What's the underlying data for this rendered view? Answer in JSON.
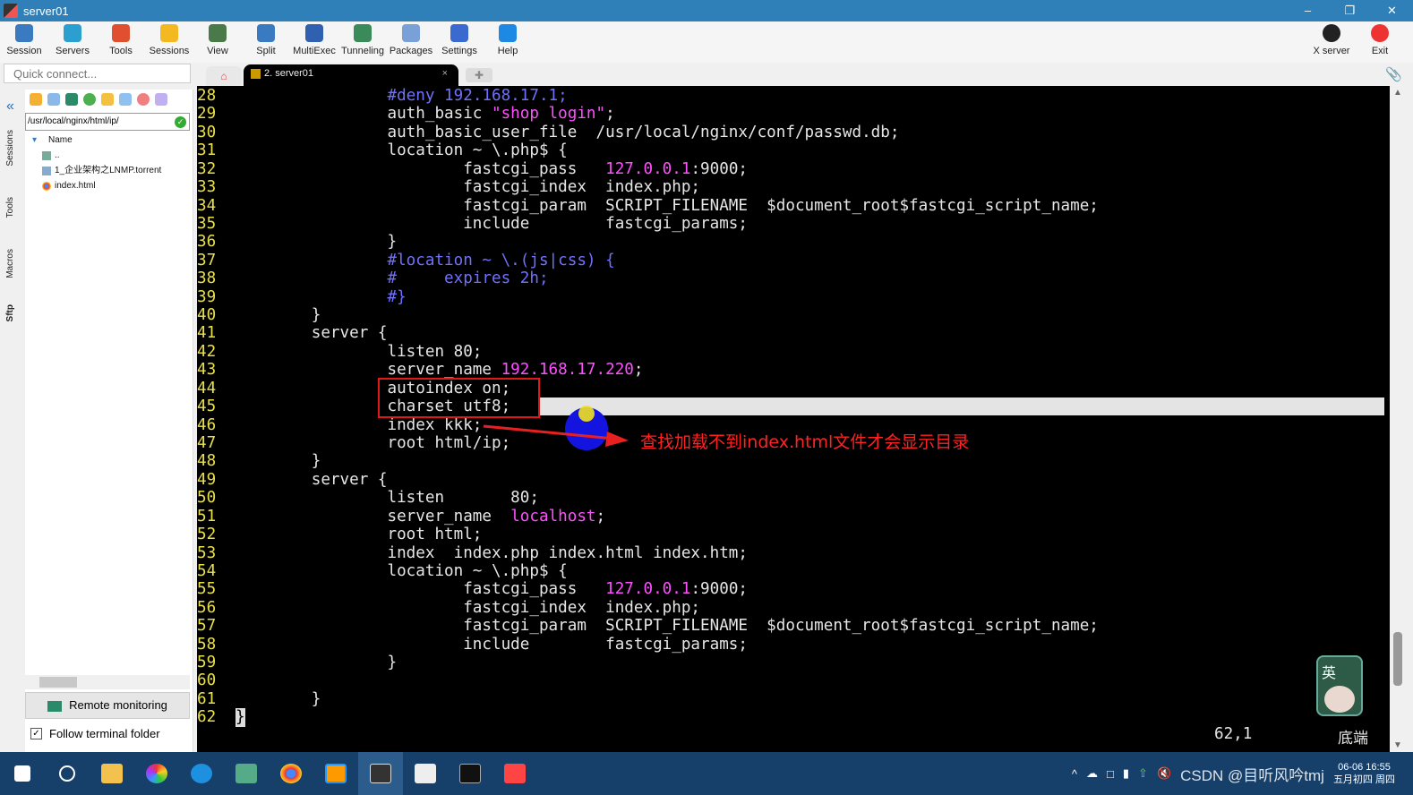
{
  "window": {
    "title": "server01"
  },
  "toolbar": {
    "items": [
      "Session",
      "Servers",
      "Tools",
      "Sessions",
      "View",
      "Split",
      "MultiExec",
      "Tunneling",
      "Packages",
      "Settings",
      "Help"
    ],
    "xserver": "X server",
    "exit": "Exit"
  },
  "quick_connect": {
    "placeholder": "Quick connect..."
  },
  "side_tabs": [
    "Sessions",
    "Tools",
    "Macros",
    "Sftp"
  ],
  "sftp": {
    "path": "/usr/local/nginx/html/ip/",
    "column": "Name",
    "files": [
      "..",
      "1_企业架构之LNMP.torrent",
      "index.html"
    ],
    "remote_monitoring": "Remote monitoring",
    "follow_label": "Follow terminal folder",
    "follow_checked": true
  },
  "tabs": {
    "active": "2. server01"
  },
  "terminal": {
    "lines": [
      {
        "n": "28",
        "s": [
          [
            "                ",
            "n"
          ],
          [
            "#deny 192.168.17.1;",
            "cm"
          ]
        ]
      },
      {
        "n": "29",
        "s": [
          [
            "                auth_basic ",
            "n"
          ],
          [
            "\"shop login\"",
            "st"
          ],
          [
            ";",
            "n"
          ]
        ]
      },
      {
        "n": "30",
        "s": [
          [
            "                auth_basic_user_file  /usr/local/nginx/conf/passwd.db;",
            "n"
          ]
        ]
      },
      {
        "n": "31",
        "s": [
          [
            "                location ~ \\.php$ {",
            "n"
          ]
        ]
      },
      {
        "n": "32",
        "s": [
          [
            "                        fastcgi_pass   ",
            "n"
          ],
          [
            "127.0.0.1",
            "st"
          ],
          [
            ":9000;",
            "n"
          ]
        ]
      },
      {
        "n": "33",
        "s": [
          [
            "                        fastcgi_index  index.php;",
            "n"
          ]
        ]
      },
      {
        "n": "34",
        "s": [
          [
            "                        fastcgi_param  SCRIPT_FILENAME  $document_root$fastcgi_script_name;",
            "n"
          ]
        ]
      },
      {
        "n": "35",
        "s": [
          [
            "                        include        fastcgi_params;",
            "n"
          ]
        ]
      },
      {
        "n": "36",
        "s": [
          [
            "                }",
            "n"
          ]
        ]
      },
      {
        "n": "37",
        "s": [
          [
            "                ",
            "n"
          ],
          [
            "#location ~ \\.(js|css) {",
            "cm"
          ]
        ]
      },
      {
        "n": "38",
        "s": [
          [
            "                ",
            "n"
          ],
          [
            "#     expires 2h;",
            "cm"
          ]
        ]
      },
      {
        "n": "39",
        "s": [
          [
            "                ",
            "n"
          ],
          [
            "#}",
            "cm"
          ]
        ]
      },
      {
        "n": "40",
        "s": [
          [
            "        }",
            "n"
          ]
        ]
      },
      {
        "n": "41",
        "s": [
          [
            "        server {",
            "n"
          ]
        ]
      },
      {
        "n": "42",
        "s": [
          [
            "                listen 80;",
            "n"
          ]
        ]
      },
      {
        "n": "43",
        "s": [
          [
            "                server_name ",
            "n"
          ],
          [
            "192.168.17.220",
            "st"
          ],
          [
            ";",
            "n"
          ]
        ]
      },
      {
        "n": "44",
        "s": [
          [
            "                autoindex on;",
            "n"
          ]
        ]
      },
      {
        "n": "45",
        "s": [
          [
            "                charset utf8;",
            "n"
          ]
        ]
      },
      {
        "n": "46",
        "s": [
          [
            "                index kkk;",
            "n"
          ]
        ]
      },
      {
        "n": "47",
        "s": [
          [
            "                root html/ip;",
            "n"
          ]
        ]
      },
      {
        "n": "48",
        "s": [
          [
            "        }",
            "n"
          ]
        ]
      },
      {
        "n": "49",
        "s": [
          [
            "        server {",
            "n"
          ]
        ]
      },
      {
        "n": "50",
        "s": [
          [
            "                listen       80;",
            "n"
          ]
        ]
      },
      {
        "n": "51",
        "s": [
          [
            "                server_name  ",
            "n"
          ],
          [
            "localhost",
            "st"
          ],
          [
            ";",
            "n"
          ]
        ]
      },
      {
        "n": "52",
        "s": [
          [
            "                root html;",
            "n"
          ]
        ]
      },
      {
        "n": "53",
        "s": [
          [
            "                index  index.php index.html index.htm;",
            "n"
          ]
        ]
      },
      {
        "n": "54",
        "s": [
          [
            "                location ~ \\.php$ {",
            "n"
          ]
        ]
      },
      {
        "n": "55",
        "s": [
          [
            "                        fastcgi_pass   ",
            "n"
          ],
          [
            "127.0.0.1",
            "st"
          ],
          [
            ":9000;",
            "n"
          ]
        ]
      },
      {
        "n": "56",
        "s": [
          [
            "                        fastcgi_index  index.php;",
            "n"
          ]
        ]
      },
      {
        "n": "57",
        "s": [
          [
            "                        fastcgi_param  SCRIPT_FILENAME  $document_root$fastcgi_script_name;",
            "n"
          ]
        ]
      },
      {
        "n": "58",
        "s": [
          [
            "                        include        fastcgi_params;",
            "n"
          ]
        ]
      },
      {
        "n": "59",
        "s": [
          [
            "                }",
            "n"
          ]
        ]
      },
      {
        "n": "60",
        "s": [
          [
            "",
            "n"
          ]
        ]
      },
      {
        "n": "61",
        "s": [
          [
            "        }",
            "n"
          ]
        ]
      },
      {
        "n": "62",
        "s": [
          [
            "}",
            "cursor"
          ]
        ]
      }
    ],
    "cursorline": "45",
    "annotation": "查找加载不到index.html文件才会显示目录",
    "position": "62,1",
    "scroll_status": "底端",
    "ime_label": "英"
  },
  "taskbar": {
    "clock_time": "06-06 16:55",
    "clock_date": "五月初四 周四",
    "watermark": "CSDN @目听风吟tmj"
  },
  "colors": {
    "titlebar": "#2f7fb8",
    "line_number": "#e8e04a",
    "comment": "#7070ff",
    "string": "#ff50ff",
    "annotation": "#ff2222",
    "taskbar": "#163f6a"
  }
}
